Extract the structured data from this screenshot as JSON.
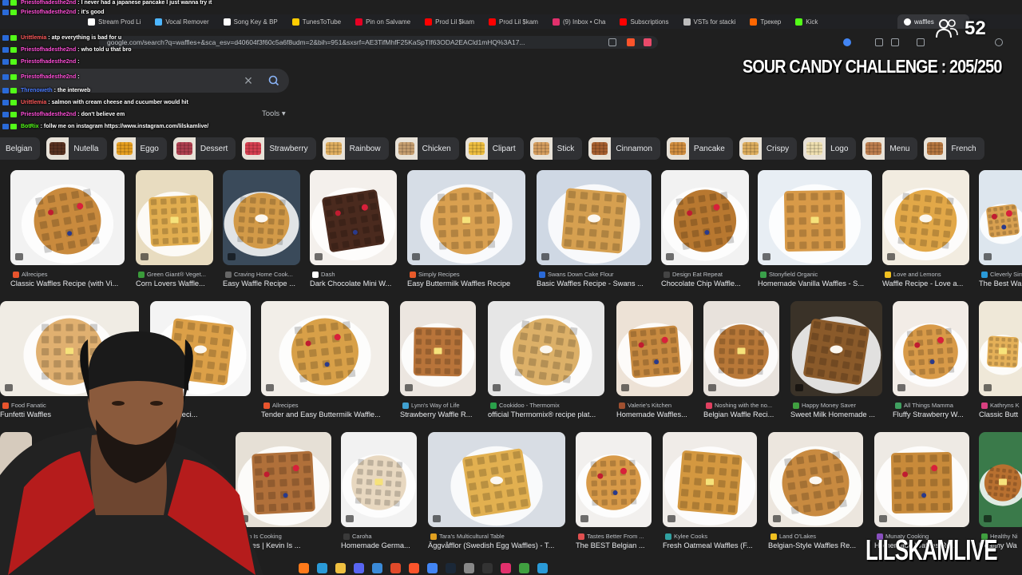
{
  "browser": {
    "url": "google.com/search?q=waffles+&sca_esv=d40604f3f60c5a6f8udm=2&bih=951&sxsrf=AE3TifMhfF25KaSpTIf63ODA2EACld1mHQ%3A17...",
    "active_tab": "waffles",
    "bookmarks": [
      {
        "label": "Stream Prod Li",
        "color": "#ffffff",
        "icon": "page-icon"
      },
      {
        "label": "Vocal Remover",
        "color": "#4db6ff",
        "icon": "wave-icon"
      },
      {
        "label": "Song Key & BP",
        "color": "#ffffff",
        "icon": "page-icon"
      },
      {
        "label": "TunesToTube",
        "color": "#ffcc00",
        "icon": "page-icon"
      },
      {
        "label": "Pin on Salvame",
        "color": "#e60023",
        "icon": "pinterest-icon"
      },
      {
        "label": "Prod Lil $kam",
        "color": "#ff0000",
        "icon": "youtube-icon"
      },
      {
        "label": "Prod Lil $kam",
        "color": "#ff0000",
        "icon": "youtube-icon"
      },
      {
        "label": "(9) Inbox • Cha",
        "color": "#e1306c",
        "icon": "instagram-icon"
      },
      {
        "label": "Subscriptions",
        "color": "#ff0000",
        "icon": "youtube-icon"
      },
      {
        "label": "VSTs for stacki",
        "color": "#bdbdbd",
        "icon": "globe-icon"
      },
      {
        "label": "Трекер",
        "color": "#ff6600",
        "icon": "page-icon"
      },
      {
        "label": "Kick",
        "color": "#53fc18",
        "icon": "kick-icon"
      }
    ]
  },
  "chat": [
    {
      "user": "Priestofhadesthe2nd",
      "text": "I never had a japanese pancake I just wanna try it",
      "color": "#ff4fd8"
    },
    {
      "user": "Priestofhadesthe2nd",
      "text": "it's good",
      "color": "#ff4fd8"
    },
    {
      "user": "Urittlemia",
      "text": "atp everything is bad for u",
      "color": "#ff5a5a"
    },
    {
      "user": "Priestofhadesthe2nd",
      "text": "who told u that bro",
      "color": "#ff4fd8"
    },
    {
      "user": "Priestofhadesthe2nd",
      "text": "",
      "color": "#ff4fd8"
    },
    {
      "user": "Priestofhadesthe2nd",
      "text": "",
      "color": "#ff4fd8"
    },
    {
      "user": "Threnoweth",
      "text": "the interweb",
      "color": "#4a7bff"
    },
    {
      "user": "Urittlemia",
      "text": "salmon with cream cheese and cucumber would hit",
      "color": "#ff5a5a"
    },
    {
      "user": "Priestofhadesthe2nd",
      "text": "don't believe em",
      "color": "#ff4fd8"
    },
    {
      "user": "BotRix",
      "text": "follw me on instagram https://www.instagram.com/lilskamlive/",
      "color": "#53fc18"
    }
  ],
  "overlay": {
    "challenge": "SOUR CANDY CHALLENGE : 205/250",
    "viewer_count": "52",
    "brand": "LILSKAMLIVE"
  },
  "search": {
    "tools_label": "Tools"
  },
  "chips": [
    {
      "label": "Belgian",
      "color": "#c98a3d"
    },
    {
      "label": "Nutella",
      "color": "#5a3220"
    },
    {
      "label": "Eggo",
      "color": "#e8a020"
    },
    {
      "label": "Dessert",
      "color": "#b04050"
    },
    {
      "label": "Strawberry",
      "color": "#d84050"
    },
    {
      "label": "Rainbow",
      "color": "#e2b060"
    },
    {
      "label": "Chicken",
      "color": "#c8a070"
    },
    {
      "label": "Clipart",
      "color": "#f0c040"
    },
    {
      "label": "Stick",
      "color": "#d8a060"
    },
    {
      "label": "Cinnamon",
      "color": "#a86030"
    },
    {
      "label": "Pancake",
      "color": "#d49040"
    },
    {
      "label": "Crispy",
      "color": "#e0b060"
    },
    {
      "label": "Logo",
      "color": "#f0e0b0"
    },
    {
      "label": "Menu",
      "color": "#c08050"
    },
    {
      "label": "French",
      "color": "#b87840"
    }
  ],
  "results": [
    [
      {
        "source": "Allrecipes",
        "title": "Classic Waffles Recipe (with Vi...",
        "bg": "#f2f2f2",
        "waffle": "#c98a3d",
        "src_color": "#e8542d"
      },
      {
        "source": "Green Giant® Veget...",
        "title": "Corn Lovers Waffle...",
        "bg": "#e8dcc0",
        "waffle": "#e1ad4f",
        "src_color": "#3a9b3a"
      },
      {
        "source": "Craving Home Cook...",
        "title": "Easy Waffle Recipe ...",
        "bg": "#3a4a5a",
        "waffle": "#d29a48",
        "src_color": "#666666"
      },
      {
        "source": "Dash",
        "title": "Dark Chocolate Mini W...",
        "bg": "#f4f0ec",
        "waffle": "#4a2a1e",
        "src_color": "#ffffff"
      },
      {
        "source": "Simply Recipes",
        "title": "Easy Buttermilk Waffles Recipe",
        "bg": "#d6dde6",
        "waffle": "#d9a050",
        "src_color": "#e85a2a"
      },
      {
        "source": "Swans Down Cake Flour",
        "title": "Basic Waffles Recipe - Swans ...",
        "bg": "#cfd8e4",
        "waffle": "#d6a050",
        "src_color": "#2a6ad8"
      },
      {
        "source": "Design Eat Repeat",
        "title": "Chocolate Chip Waffle...",
        "bg": "#f2f2f2",
        "waffle": "#b87830",
        "src_color": "#444444"
      },
      {
        "source": "Stonyfield Organic",
        "title": "Homemade Vanilla Waffles - S...",
        "bg": "#e8eef4",
        "waffle": "#d89a48",
        "src_color": "#3aa04a"
      },
      {
        "source": "Love and Lemons",
        "title": "Waffle Recipe - Love a...",
        "bg": "#f2ece0",
        "waffle": "#e2a848",
        "src_color": "#f0c020"
      },
      {
        "source": "Cleverly Sim...",
        "title": "The Best Wa",
        "bg": "#dde6ee",
        "waffle": "#d8a050",
        "src_color": "#2a9ad8"
      }
    ],
    [
      {
        "source": "Food Fanatic",
        "title": "Funfetti Waffles",
        "bg": "#f0ece4",
        "waffle": "#e0b070",
        "src_color": "#e8542d"
      },
      {
        "source": "",
        "title": "Waffles Reci...",
        "bg": "#f4f4f4",
        "waffle": "#dca048",
        "src_color": "#888888"
      },
      {
        "source": "Allrecipes",
        "title": "Tender and Easy Buttermilk Waffle...",
        "bg": "#f2eee8",
        "waffle": "#d8a048",
        "src_color": "#e8542d"
      },
      {
        "source": "Lynn's Way of Life",
        "title": "Strawberry Waffle R...",
        "bg": "#ece6e0",
        "waffle": "#b8743a",
        "src_color": "#40a0d0"
      },
      {
        "source": "Cookidoo - Thermomix",
        "title": "official Thermomix® recipe plat...",
        "bg": "#e6e6e6",
        "waffle": "#dcb068",
        "src_color": "#2aa04a"
      },
      {
        "source": "Valerie's Kitchen",
        "title": "Homemade Waffles...",
        "bg": "#ede2d6",
        "waffle": "#c88a40",
        "src_color": "#a05030"
      },
      {
        "source": "Noshing with the no...",
        "title": "Belgian Waffle Reci...",
        "bg": "#e8e2dc",
        "waffle": "#b87838",
        "src_color": "#e04060"
      },
      {
        "source": "Happy Money Saver",
        "title": "Sweet Milk Homemade ...",
        "bg": "#3a3228",
        "waffle": "#8a5a2a",
        "src_color": "#40a040"
      },
      {
        "source": "All Things Mamma",
        "title": "Fluffy Strawberry W...",
        "bg": "#f2ece6",
        "waffle": "#d89a48",
        "src_color": "#40a060"
      },
      {
        "source": "Kathryns K",
        "title": "Classic Butt",
        "bg": "#efe8d8",
        "waffle": "#e4b058",
        "src_color": "#d84080"
      }
    ],
    [
      {
        "source": "",
        "title": "",
        "bg": "#d6cbbd",
        "waffle": "#c88a40",
        "src_color": "#888888"
      },
      {
        "source": "In Is Cooking",
        "title": "Waffles | Kevin Is ...",
        "bg": "#e6e0d6",
        "waffle": "#b0703a",
        "src_color": "#d85020"
      },
      {
        "source": "Caroha",
        "title": "Homemade Germa...",
        "bg": "#f2f2f2",
        "waffle": "#e8d8c0",
        "src_color": "#3a3a3a"
      },
      {
        "source": "Tara's Multicultural Table",
        "title": "Äggvåfflor (Swedish Egg Waffles) - T...",
        "bg": "#d8dde4",
        "waffle": "#e2b050",
        "src_color": "#e0a020"
      },
      {
        "source": "Tastes Better From ...",
        "title": "The BEST Belgian ...",
        "bg": "#f2f0ee",
        "waffle": "#d89a48",
        "src_color": "#e05050"
      },
      {
        "source": "Kylee Cooks",
        "title": "Fresh Oatmeal Waffles (F...",
        "bg": "#f0ece8",
        "waffle": "#d49840",
        "src_color": "#30a0a0"
      },
      {
        "source": "Land O'Lakes",
        "title": "Belgian-Style Waffles Re...",
        "bg": "#ece6de",
        "waffle": "#c88a40",
        "src_color": "#f0c020"
      },
      {
        "source": "Munaty Cooking",
        "title": "Homemade Waffles Re...",
        "bg": "#eeeae4",
        "waffle": "#c88a3a",
        "src_color": "#8a50c0"
      },
      {
        "source": "Healthy Ni",
        "title": "Healthy Wa",
        "bg": "#3a7a4a",
        "waffle": "#b87030",
        "src_color": "#40a040"
      }
    ]
  ],
  "taskbar": [
    {
      "icon": "app-icon",
      "color": "#ff7a1a"
    },
    {
      "icon": "edge-icon",
      "color": "#2a9ad8"
    },
    {
      "icon": "folder-icon",
      "color": "#f0c040"
    },
    {
      "icon": "discord-icon",
      "color": "#5865f2"
    },
    {
      "icon": "store-icon",
      "color": "#3a8ad8"
    },
    {
      "icon": "app-icon",
      "color": "#e04a2a"
    },
    {
      "icon": "brave-icon",
      "color": "#fb542b"
    },
    {
      "icon": "chrome-icon",
      "color": "#4285f4"
    },
    {
      "icon": "steam-icon",
      "color": "#1b2838"
    },
    {
      "icon": "app-icon",
      "color": "#888888"
    },
    {
      "icon": "app-icon",
      "color": "#333333"
    },
    {
      "icon": "instagram-icon",
      "color": "#e1306c"
    },
    {
      "icon": "app-icon",
      "color": "#40a040"
    },
    {
      "icon": "app-icon",
      "color": "#2a9ad8"
    }
  ]
}
